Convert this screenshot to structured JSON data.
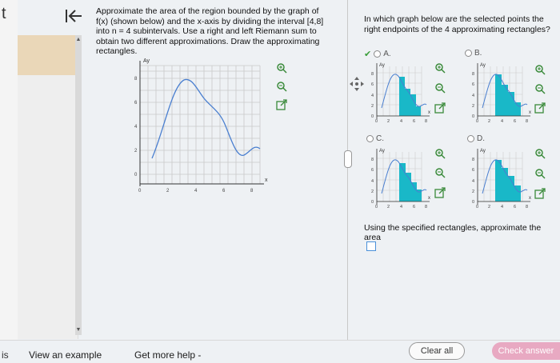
{
  "left_strip": {
    "letter": "t",
    "bottom_text": "is"
  },
  "question": {
    "text": "Approximate the area of the region bounded by the graph of f(x) (shown below) and the x-axis by dividing the interval [4,8] into n = 4 subintervals. Use a right and left Riemann sum to obtain two different approximations. Draw the approximating rectangles."
  },
  "main_graph": {
    "y_axis_label": "Ay",
    "x_axis_label": "x",
    "x_ticks": [
      "0",
      "2",
      "4",
      "6",
      "8"
    ],
    "y_ticks": [
      "0",
      "2",
      "4",
      "6",
      "8"
    ]
  },
  "prompt": {
    "text": "In which graph below are the selected points the right endpoints of the 4 approximating rectangles?"
  },
  "options": {
    "a": "A.",
    "b": "B.",
    "c": "C.",
    "d": "D."
  },
  "mini_graph": {
    "y_axis_label": "Ay",
    "x_axis_label": "x",
    "x_ticks": [
      "0",
      "2",
      "4",
      "6",
      "8"
    ],
    "y_ticks": [
      "0",
      "2",
      "4",
      "6",
      "8"
    ]
  },
  "area_prompt": "Using the specified rectangles, approximate the area",
  "footer": {
    "view_example": "View an example",
    "get_help": "Get more help -",
    "clear_all": "Clear all",
    "check_answer": "Check answer"
  },
  "colors": {
    "accent": "#4a90d9",
    "fill": "#19b8c8",
    "check_button": "#e8a9c2",
    "curve": "#4a7fd0"
  },
  "icons": [
    "back-arrow-icon",
    "zoom-in-icon",
    "zoom-out-icon",
    "popout-icon",
    "move-icon"
  ]
}
